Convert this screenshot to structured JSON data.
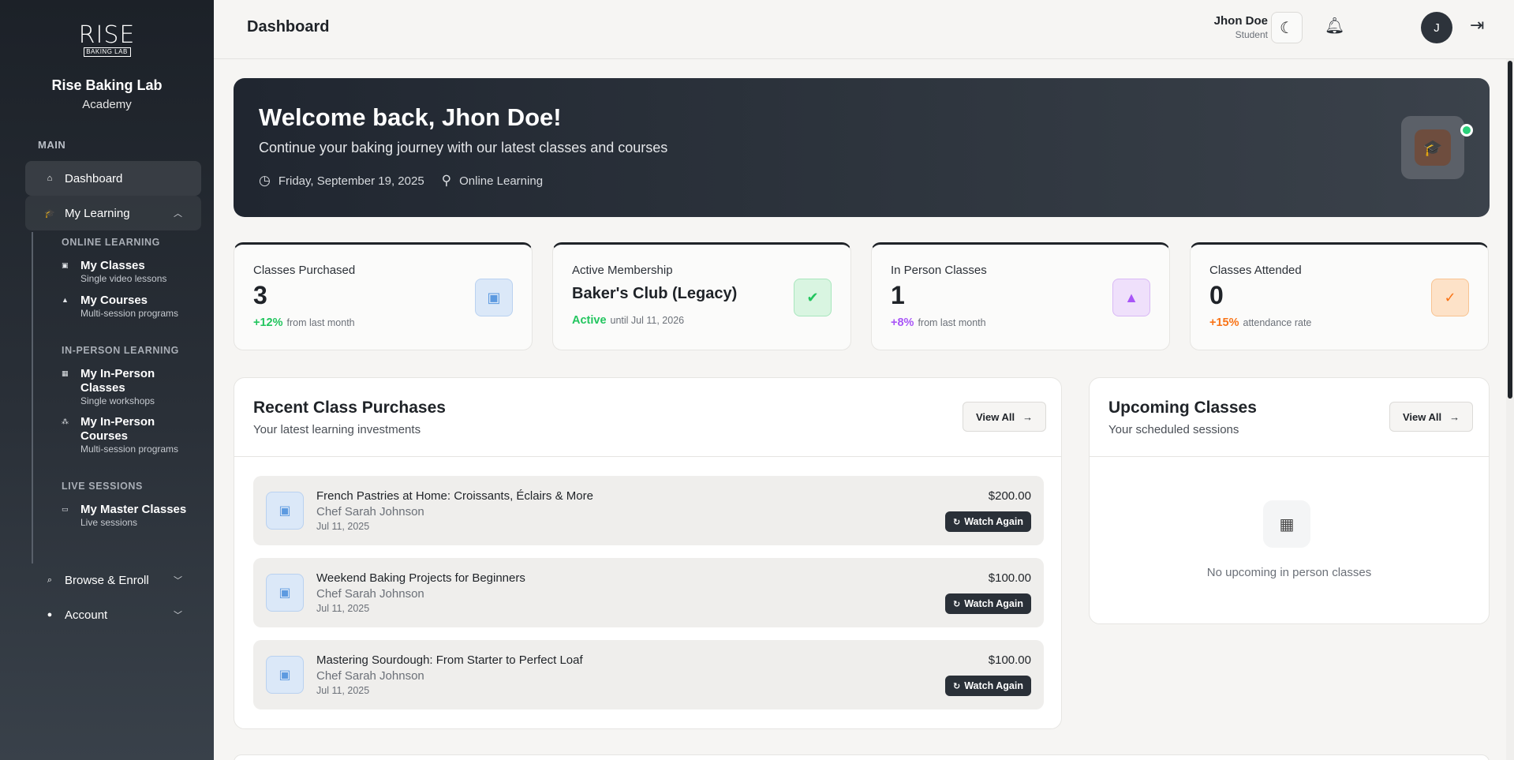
{
  "brand": {
    "logo_text": "RISE",
    "logo_sub": "BAKING LAB",
    "title": "Rise Baking Lab",
    "subtitle": "Academy"
  },
  "sidebar": {
    "section_main": "MAIN",
    "dashboard": "Dashboard",
    "my_learning": "My Learning",
    "online_label": "ONLINE LEARNING",
    "my_classes": {
      "title": "My Classes",
      "desc": "Single video lessons"
    },
    "my_courses": {
      "title": "My Courses",
      "desc": "Multi-session programs"
    },
    "inperson_label": "IN-PERSON LEARNING",
    "my_inperson_classes": {
      "title": "My In-Person Classes",
      "desc": "Single workshops"
    },
    "my_inperson_courses": {
      "title": "My In-Person Courses",
      "desc": "Multi-session programs"
    },
    "live_label": "LIVE SESSIONS",
    "my_master_classes": {
      "title": "My Master Classes",
      "desc": "Live sessions"
    },
    "browse_enroll": "Browse & Enroll",
    "account": "Account"
  },
  "header": {
    "title": "Dashboard",
    "user_name": "Jhon Doe",
    "user_role": "Student",
    "avatar_initial": "J"
  },
  "hero": {
    "title": "Welcome back, Jhon Doe!",
    "subtitle": "Continue your baking journey with our latest classes and courses",
    "date": "Friday, September 19, 2025",
    "location": "Online Learning"
  },
  "stats": [
    {
      "label": "Classes Purchased",
      "value": "3",
      "highlight": "+12%",
      "foot": "from last month",
      "color": "#22c55e",
      "icon": "video-library-icon"
    },
    {
      "label": "Active Membership",
      "value": "Baker's Club (Legacy)",
      "highlight": "Active",
      "foot": "until Jul 11, 2026",
      "color": "#22c55e",
      "icon": "verified-badge-icon"
    },
    {
      "label": "In Person Classes",
      "value": "1",
      "highlight": "+8%",
      "foot": "from last month",
      "color": "#a855f7",
      "icon": "graduation-cap-icon"
    },
    {
      "label": "Classes Attended",
      "value": "0",
      "highlight": "+15%",
      "foot": "attendance rate",
      "color": "#f97316",
      "icon": "check-circle-icon"
    }
  ],
  "recent": {
    "title": "Recent Class Purchases",
    "subtitle": "Your latest learning investments",
    "view_all": "View All",
    "button_label": "Watch Again",
    "items": [
      {
        "title": "French Pastries at Home: Croissants, Éclairs & More",
        "chef": "Chef Sarah Johnson",
        "date": "Jul 11, 2025",
        "price": "$200.00"
      },
      {
        "title": "Weekend Baking Projects for Beginners",
        "chef": "Chef Sarah Johnson",
        "date": "Jul 11, 2025",
        "price": "$100.00"
      },
      {
        "title": "Mastering Sourdough: From Starter to Perfect Loaf",
        "chef": "Chef Sarah Johnson",
        "date": "Jul 11, 2025",
        "price": "$100.00"
      }
    ]
  },
  "upcoming": {
    "title": "Upcoming Classes",
    "subtitle": "Your scheduled sessions",
    "view_all": "View All",
    "empty": "No upcoming in person classes"
  }
}
